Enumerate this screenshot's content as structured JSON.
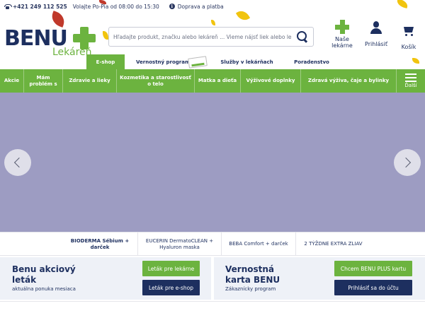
{
  "topbar": {
    "phone": "+421 249 112 525",
    "hours": "Volajte Po-Pia od 08:00 do 15:30",
    "shipping": "Doprava a platba"
  },
  "logo": {
    "name": "BENU",
    "subtitle": "Lekáreň"
  },
  "search": {
    "placeholder": "Hľadajte produkt, značku alebo lekáreň ... Vieme nájsť liek alebo lekáreň"
  },
  "header": {
    "pharmacies": [
      "Naše",
      "lekárne"
    ],
    "login": "Prihlásiť",
    "cart": "Košík"
  },
  "tabs": [
    {
      "label": "E-shop",
      "active": true
    },
    {
      "label": "Vernostný program"
    },
    {
      "label": "Služby v lekárňach"
    },
    {
      "label": "Poradenstvo"
    }
  ],
  "nav": {
    "items": [
      "Akcie",
      "Mám problém s",
      "Zdravie a lieky",
      "Kozmetika a starostlivosť o telo",
      "Matka a dieťa",
      "Výživové doplnky",
      "Zdravá výživa, čaje a bylinky"
    ],
    "more": "Ďalší"
  },
  "slider_tabs": [
    "BIODERMA Sébium + darček",
    "EUCERIN DermatoCLEAN + Hyaluron maska",
    "BEBA Comfort + darček",
    "2 TÝŽDNE EXTRA ZLIAV"
  ],
  "promo_left": {
    "title_1": "Benu akciový",
    "title_2": "leták",
    "subtitle": "aktuálna ponuka mesiaca",
    "btn_1": "Leták pre lekárne",
    "btn_2": "Leták pre e-shop"
  },
  "promo_right": {
    "title_1": "Vernostná",
    "title_2": "karta BENU",
    "subtitle": "Zákaznícky program",
    "btn_1": "Chcem BENU PLUS kartu",
    "btn_2": "Prihlásiť sa do účtu"
  },
  "colors": {
    "brand_green": "#6cb33f",
    "brand_navy": "#1d2f5f",
    "hero_bg": "#9d9cc2"
  }
}
